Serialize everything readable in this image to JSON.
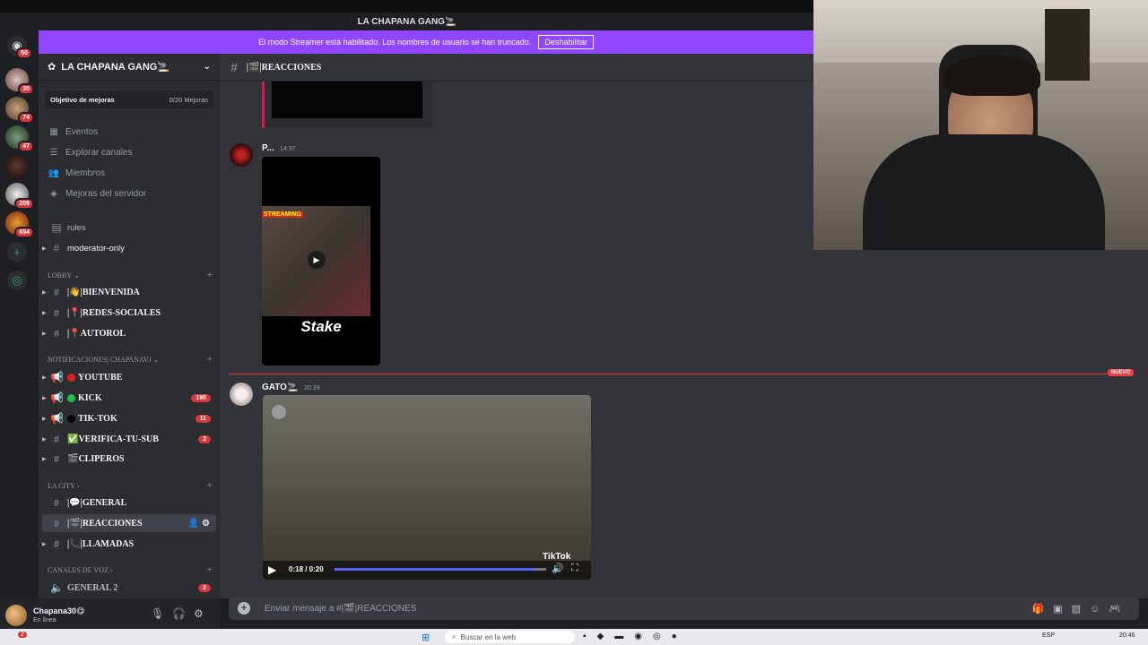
{
  "window": {
    "title": "LA CHAPANA GANG🚬"
  },
  "streamer_bar": {
    "text": "El modo Streamer está habilitado. Los nombres de usuario se han truncado.",
    "button": "Deshabilitar"
  },
  "rail": {
    "badges": [
      "50",
      "30",
      "74",
      "47",
      "209",
      "654"
    ]
  },
  "server": {
    "name": "LA CHAPANA GANG🚬"
  },
  "boost": {
    "label": "Objetivo de mejoras",
    "count": "0/20 Mejoras"
  },
  "menu": {
    "events": "Eventos",
    "explore": "Explorar canales",
    "members": "Miembros",
    "boosts": "Mejoras del servidor"
  },
  "channels": {
    "rules": "rules",
    "moderator": "moderator-only",
    "lobby": "LOBBY",
    "bienvenida": "|👋|BIENVENIDA",
    "redes": "|📍|REDES-SOCIALES",
    "autorol": "|📍AUTOROL",
    "notif": "NOTIFICACIONES| CHAPANAVJ",
    "youtube": "YOUTUBE",
    "kick": "KICK",
    "kick_badge": "190",
    "tiktok": "TIK-TOK",
    "tiktok_badge": "11",
    "verifica": "✅VERIFICA-TU-SUB",
    "verifica_badge": "2",
    "clip": "🎬CLIPEROS",
    "city": "LA CITY",
    "general": "|💬|GENERAL",
    "reacciones": "|🎬|REACCIONES",
    "llamadas": "|📞|LLAMADAS",
    "voice": "CANALES DE VOZ",
    "general2": "GENERAL 2",
    "general2_badge": "2"
  },
  "user": {
    "name": "Chapana30😋",
    "status": "En línea"
  },
  "header": {
    "channel": "|🎬|REACCIONES"
  },
  "messages": [
    {
      "author": "P...",
      "time": "14:37",
      "video_text_top": "STREAMING",
      "video_brand": "Stake"
    },
    {
      "author": "GATO🚬",
      "time": "20:39",
      "video_time": "0:18 / 0:20",
      "progress": 0.95,
      "watermark": "TikTok"
    }
  ],
  "divider": {
    "label": "NUEVO"
  },
  "composer": {
    "placeholder": "Enviar mensaje a #|🎬|REACCIONES"
  },
  "taskbar": {
    "search": "Buscar en la web",
    "lang": "ESP",
    "time": "20:46",
    "notif": "2"
  }
}
